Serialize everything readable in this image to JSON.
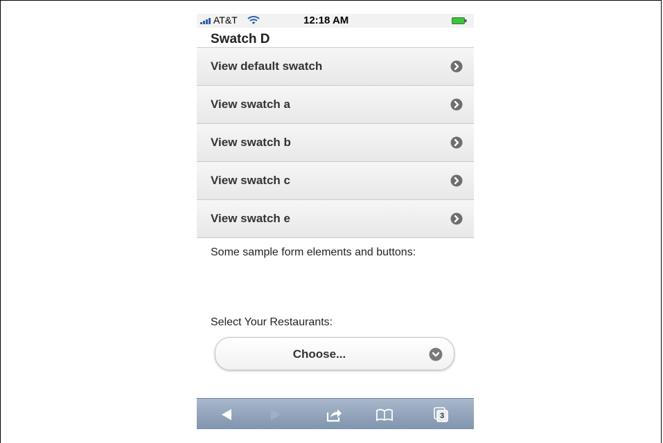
{
  "status_bar": {
    "carrier": "AT&T",
    "time": "12:18 AM",
    "signal_icon": "signal-bars-icon",
    "wifi_icon": "wifi-icon",
    "battery_icon": "battery-icon"
  },
  "page": {
    "title": "Swatch D"
  },
  "list": {
    "items": [
      {
        "label": "View default swatch",
        "icon": "chevron-right-icon"
      },
      {
        "label": "View swatch a",
        "icon": "chevron-right-icon"
      },
      {
        "label": "View swatch b",
        "icon": "chevron-right-icon"
      },
      {
        "label": "View swatch c",
        "icon": "chevron-right-icon"
      },
      {
        "label": "View swatch e",
        "icon": "chevron-right-icon"
      }
    ]
  },
  "form": {
    "intro": "Some sample form elements and buttons:",
    "select_label": "Select Your Restaurants:",
    "select_value": "Choose..."
  },
  "toolbar": {
    "buttons": [
      "back-icon",
      "forward-icon",
      "share-icon",
      "bookmarks-icon",
      "tabs-icon"
    ],
    "tab_count": "3"
  },
  "colors": {
    "toolbar": "#8fa2bb",
    "list_bg": "#efefef",
    "arrow": "#6e6e6e",
    "signal": "#2f5ea8",
    "battery": "#3fc23f"
  }
}
